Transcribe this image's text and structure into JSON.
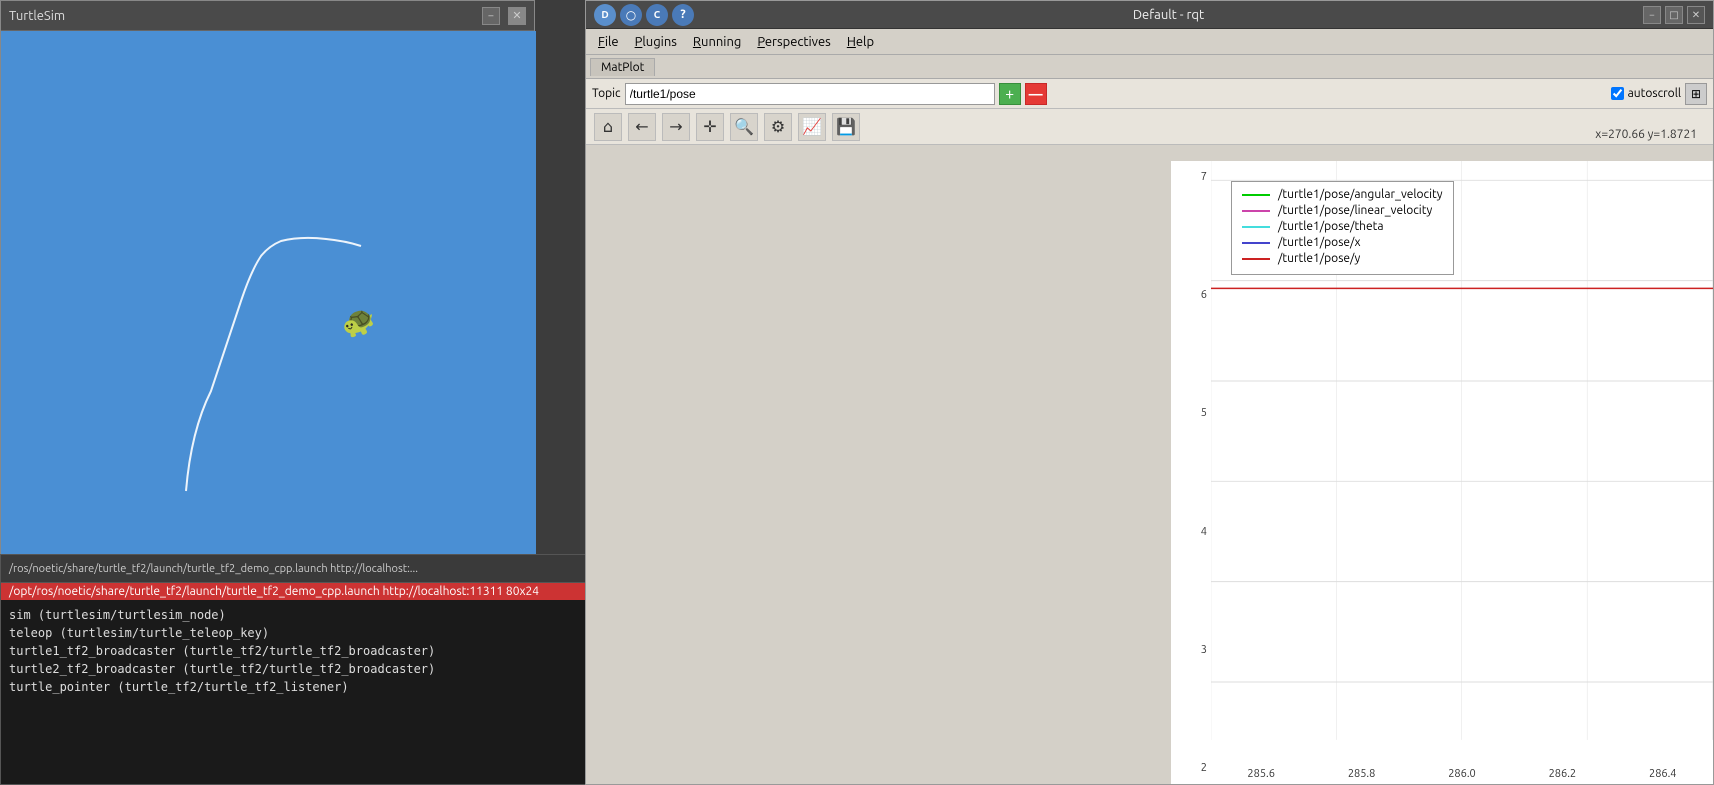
{
  "turtlesim": {
    "title": "TurtleSim",
    "min_btn": "−",
    "close_btn": "✕"
  },
  "terminal": {
    "title": "/ros/noetic/share/turtle_tf2/launch/turtle_tf2_demo_cpp.launch http://localhost:...",
    "title_short": "/opt/ros/noetic/share/turtle_tf2/launch/turtle_tf2_demo_cpp.launch http://localhost:11311 80x24",
    "min_btn": "−",
    "max_btn": "□",
    "lines": [
      "sim (turtlesim/turtlesim_node)",
      "teleop (turtlesim/turtle_teleop_key)",
      "turtle1_tf2_broadcaster (turtle_tf2/turtle_tf2_broadcaster)",
      "turtle2_tf2_broadcaster (turtle_tf2/turtle_tf2_broadcaster)",
      "turtle_pointer (turtle_tf2/turtle_tf2_listener)"
    ]
  },
  "rqt": {
    "title": "Default - rqt",
    "close_btn": "✕",
    "minimize_btn": "−",
    "maximize_btn": "□",
    "corner_btns": [
      "D",
      "○",
      "C",
      "?"
    ],
    "menu": {
      "file": "File",
      "plugins": "Plugins",
      "running": "Running",
      "perspectives": "Perspectives",
      "help": "Help"
    },
    "tab": "MatPlot",
    "topic_label": "Topic",
    "topic_value": "/turtle1/pose",
    "add_btn": "+",
    "remove_btn": "—",
    "autoscroll": "autoscroll",
    "autoscroll_checked": true,
    "coord_display": "x=270.66    y=1.8721"
  },
  "plot": {
    "legend": [
      {
        "label": "/turtle1/pose/angular_velocity",
        "color": "#00cc00"
      },
      {
        "label": "/turtle1/pose/linear_velocity",
        "color": "#cc44aa"
      },
      {
        "label": "/turtle1/pose/theta",
        "color": "#44dddd"
      },
      {
        "label": "/turtle1/pose/x",
        "color": "#4444cc"
      },
      {
        "label": "/turtle1/pose/y",
        "color": "#cc2222"
      }
    ],
    "y_labels": [
      "7",
      "6",
      "5",
      "4",
      "3",
      "2"
    ],
    "x_labels": [
      "285.6",
      "285.8",
      "286.0",
      "286.2",
      "286.4"
    ],
    "toolbar_icons": [
      "⌂",
      "←",
      "→",
      "✛",
      "🔍",
      "⚙",
      "📈",
      "💾"
    ]
  }
}
